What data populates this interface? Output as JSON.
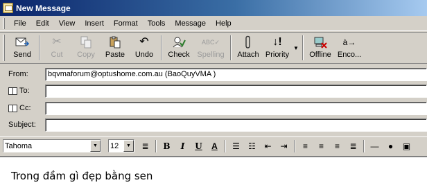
{
  "window": {
    "title": "New Message"
  },
  "menu": [
    "File",
    "Edit",
    "View",
    "Insert",
    "Format",
    "Tools",
    "Message",
    "Help"
  ],
  "toolbar": {
    "buttons": [
      {
        "label": "Send",
        "icon": "send-icon",
        "enabled": true
      },
      {
        "label": "Cut",
        "icon": "cut-icon",
        "enabled": false
      },
      {
        "label": "Copy",
        "icon": "copy-icon",
        "enabled": false
      },
      {
        "label": "Paste",
        "icon": "paste-icon",
        "enabled": true
      },
      {
        "label": "Undo",
        "icon": "undo-icon",
        "enabled": true
      },
      {
        "label": "Check",
        "icon": "check-names-icon",
        "enabled": true
      },
      {
        "label": "Spelling",
        "icon": "spelling-icon",
        "enabled": false
      },
      {
        "label": "Attach",
        "icon": "paperclip-icon",
        "enabled": true
      },
      {
        "label": "Priority",
        "icon": "priority-icon",
        "enabled": true
      },
      {
        "label": "Offline",
        "icon": "offline-icon",
        "enabled": true
      },
      {
        "label": "Enco...",
        "icon": "encoding-icon",
        "enabled": true
      }
    ]
  },
  "headers": {
    "from_label": "From:",
    "from_value": "bqvmaforum@optushome.com.au    (BaoQuyVMA )",
    "to_label": "To:",
    "to_value": "",
    "cc_label": "Cc:",
    "cc_value": "",
    "subject_label": "Subject:",
    "subject_value": ""
  },
  "format": {
    "font": "Tahoma",
    "size": "12"
  },
  "message": {
    "body": "Trong đầm gì đẹp bằng sen"
  }
}
